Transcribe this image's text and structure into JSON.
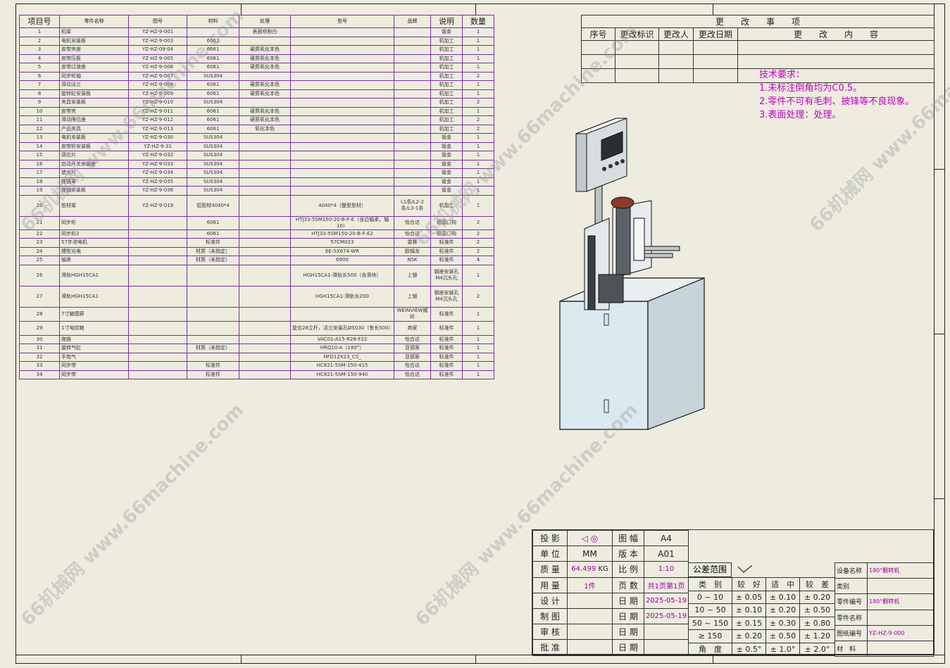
{
  "bom": {
    "headers": [
      "项目号",
      "零件名称",
      "图号",
      "材料",
      "处理",
      "型号",
      "品牌",
      "说明",
      "数量"
    ],
    "rows": [
      [
        "1",
        "机架",
        "YZ-HZ-9-001",
        "",
        "表面喷粉白",
        "",
        "",
        "钣金",
        "1"
      ],
      [
        "2",
        "电机安装板",
        "YZ-HZ-9-003",
        "6061",
        "",
        "",
        "",
        "机加工",
        "1"
      ],
      [
        "3",
        "皮带夹座",
        "YZ-HZ-09-04",
        "6061",
        "硬质氧化本色",
        "",
        "",
        "机加工",
        "1"
      ],
      [
        "4",
        "皮带压板",
        "YZ-HZ-9-005",
        "6061",
        "硬质氧化本色",
        "",
        "",
        "机加工",
        "1"
      ],
      [
        "5",
        "皮带过渡座",
        "YZ-HZ-9-006",
        "6061",
        "硬质氧化本色",
        "",
        "",
        "机加工",
        "1"
      ],
      [
        "6",
        "同步轮轴",
        "YZ-HZ-9-007",
        "SUS304",
        "",
        "",
        "",
        "机加工",
        "2"
      ],
      [
        "7",
        "滑动法兰",
        "YZ-HZ-9-008",
        "6061",
        "硬质氧化本色",
        "",
        "",
        "机加工",
        "1"
      ],
      [
        "8",
        "旋转缸安装板",
        "YZ-HZ-9-009",
        "6061",
        "硬质氧化本色",
        "",
        "",
        "机加工",
        "1"
      ],
      [
        "9",
        "夹具安装板",
        "YZ-HZ-9-010",
        "SUS304",
        "",
        "",
        "",
        "机加工",
        "2"
      ],
      [
        "10",
        "皮带夹",
        "YZ-HZ-9-011",
        "6061",
        "硬质氧化本色",
        "",
        "",
        "机加工",
        "1"
      ],
      [
        "11",
        "滑动限位座",
        "YZ-HZ-9-012",
        "6061",
        "硬质氧化本色",
        "",
        "",
        "机加工",
        "2"
      ],
      [
        "12",
        "产品夹具",
        "YZ-HZ-9-013",
        "6061",
        "氧化本色",
        "",
        "",
        "机加工",
        "2"
      ],
      [
        "13",
        "电机安装板",
        "YZ-HZ-9-030",
        "SUS304",
        "",
        "",
        "",
        "钣金",
        "1"
      ],
      [
        "14",
        "皮带轮安装板",
        "YZ-HZ-9-31",
        "SUS304",
        "",
        "",
        "",
        "钣金",
        "1"
      ],
      [
        "15",
        "感应片",
        "YZ-HZ-9-032",
        "SUS304",
        "",
        "",
        "",
        "钣金",
        "1"
      ],
      [
        "16",
        "启动开关安装座",
        "YZ-HZ-9-033",
        "SUS304",
        "",
        "",
        "",
        "钣金",
        "1"
      ],
      [
        "17",
        "遮光片",
        "YZ-HZ-9-034",
        "SUS304",
        "",
        "",
        "",
        "钣金",
        "1"
      ],
      [
        "18",
        "拖链罩",
        "YZ-HZ-9-035",
        "SUS304",
        "",
        "",
        "",
        "钣金",
        "1"
      ],
      [
        "19",
        "拖链安装板",
        "YZ-HZ-9-036",
        "SUS304",
        "",
        "",
        "",
        "钣金",
        "1"
      ],
      [
        "20",
        "型材架",
        "YZ-HZ-9-019",
        "铝型材4040*4",
        "",
        "4040*4（整型型材）",
        "L1条/L2-2条/L3-1条",
        "机加工",
        "1"
      ],
      [
        "21",
        "同步轮",
        "",
        "6061",
        "",
        "HTJ33-5SM150-20-B-F-E（含边轴承，轴10）",
        "怡合达",
        "德国订购",
        "2"
      ],
      [
        "22",
        "同步轮2",
        "",
        "6061",
        "",
        "HTJ33-5SM150-20-B-F-E2",
        "怡合达",
        "德国订购",
        "2"
      ],
      [
        "23",
        "57步进电机",
        "",
        "标准件",
        "",
        "57CM023",
        "雷赛",
        "标准件",
        "2"
      ],
      [
        "24",
        "槽型光电",
        "",
        "材质（未指定）",
        "",
        "EE-SX674-WR",
        "欧姆龙",
        "标准件",
        "2"
      ],
      [
        "25",
        "轴承",
        "",
        "材质（未指定）",
        "",
        "6900",
        "NSK",
        "标准件",
        "4"
      ],
      [
        "26",
        "滑轨HGH15CA1",
        "",
        "",
        "",
        "HGH15CA1-滑轨长500（含滑块）",
        "上银",
        "钢座安装孔M4沉头孔",
        "1"
      ],
      [
        "27",
        "滑轨HGH15CA1",
        "",
        "",
        "",
        "HGH15CA1-滑轨长200",
        "上银",
        "钢座安装孔M4沉头孔",
        "2"
      ],
      [
        "28",
        "7寸触摸屏",
        "",
        "",
        "",
        "",
        "WEINVIEW威纶",
        "标准件",
        "1"
      ],
      [
        "29",
        "1寸电控箱",
        "",
        "",
        "",
        "复合28立杆，活兰安装孔Ø5030（有长500）",
        "商家",
        "标准件",
        "1"
      ],
      [
        "30",
        "拖链",
        "",
        "",
        "",
        "VAC01-A15-R28-F22",
        "怡合达",
        "标准件",
        "1"
      ],
      [
        "31",
        "旋转气缸",
        "",
        "材质（未指定）",
        "",
        "HRQ10-A（180°）",
        "亚德客",
        "标准件",
        "1"
      ],
      [
        "32",
        "手指气",
        "",
        "",
        "",
        "HFD12X23_CS_",
        "亚德客",
        "标准件",
        "1"
      ],
      [
        "33",
        "同步带",
        "",
        "标准件",
        "",
        "HC821-5SM-150-415",
        "怡合达",
        "标准件",
        "1"
      ],
      [
        "34",
        "同步带",
        "",
        "标准件",
        "",
        "HC821-5SM-150-940",
        "怡合达",
        "标准件",
        "1"
      ]
    ]
  },
  "revision": {
    "title": "更　　改　　事　　项",
    "headers": [
      "序号",
      "更改标识",
      "更改人",
      "更改日期",
      "更　　改　　内　　容"
    ]
  },
  "tech": {
    "title": "技术要求：",
    "lines": [
      "1.未标注倒角均为C0.5。",
      "2.零件不可有毛刺、披锋等不良现象。",
      "3.表面处理：处理。"
    ]
  },
  "titleblock": {
    "projection_label": "投 影",
    "projection_symbol": "◁ ◎",
    "sheet_label": "图 幅",
    "sheet_value": "A4",
    "unit_label": "单 位",
    "unit_value": "MM",
    "version_label": "版 本",
    "version_value": "A01",
    "mass_label": "质 量",
    "mass_value": "64.499",
    "mass_unit": "KG",
    "scale_label": "比 例",
    "scale_value": "1:10",
    "qty_label": "用 量",
    "qty_value": "1件",
    "page_label": "页 数",
    "page_value": "共1页第1页",
    "design_label": "设 计",
    "design_date_label": "日 期",
    "design_date": "2025-05-19",
    "draw_label": "制 图",
    "draw_date_label": "日 期",
    "draw_date": "2025-05-19",
    "check_label": "审 核",
    "check_date_label": "日 期",
    "approve_label": "批 准",
    "approve_date_label": "日 期",
    "tol_title": "公差范围",
    "tol_headers": [
      "类　别",
      "较　好",
      "适　中",
      "较　差"
    ],
    "tol_rows": [
      [
        "0 ~ 10",
        "± 0.05",
        "± 0.10",
        "± 0.20"
      ],
      [
        "10 ~ 50",
        "± 0.10",
        "± 0.20",
        "± 0.50"
      ],
      [
        "50 ~ 150",
        "± 0.15",
        "± 0.30",
        "± 0.80"
      ],
      [
        "≥ 150",
        "± 0.20",
        "± 0.50",
        "± 1.20"
      ],
      [
        "角　度",
        "± 0.5°",
        "± 1.0°",
        "± 2.0°"
      ]
    ],
    "device_label": "设备名称",
    "device_value": "180°翻转机",
    "category_label": "类别",
    "part_no_label": "零件编号",
    "part_no_value": "180°翻转机",
    "part_name_label": "零件名称",
    "drawing_no_label": "图纸编号",
    "drawing_no_value": "YZ-HZ-9-000",
    "material_label": "材　料"
  },
  "watermark": "66机械网 www.66machine.com",
  "colors": {
    "accent": "#a000a0",
    "table_line": "#7a2f9f",
    "background": "#edecdf"
  }
}
